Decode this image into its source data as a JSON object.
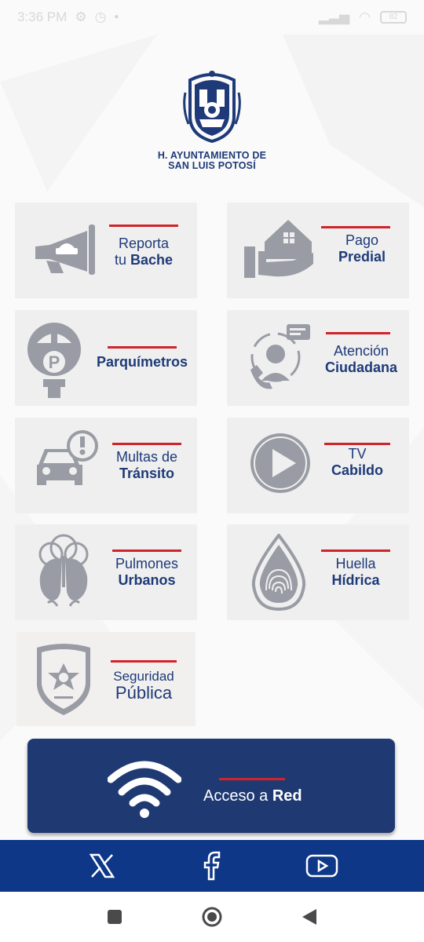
{
  "status": {
    "time": "3:36 PM",
    "battery": "82"
  },
  "brand": {
    "line1": "H. AYUNTAMIENTO DE",
    "line2": "SAN LUIS POTOSÍ"
  },
  "tiles": [
    {
      "line1": "Reporta",
      "line2": "tu ",
      "line2b": "Bache",
      "icon": "megaphone-icon"
    },
    {
      "line1": "Pago",
      "line2b": "Predial",
      "icon": "house-hand-icon"
    },
    {
      "line1b": "Parquímetros",
      "icon": "parking-meter-icon"
    },
    {
      "line1": "Atención",
      "line2b": "Ciudadana",
      "icon": "call-center-icon"
    },
    {
      "line1": "Multas de",
      "line2b": "Tránsito",
      "icon": "car-alert-icon"
    },
    {
      "line1": "TV",
      "line2b": "Cabildo",
      "icon": "play-icon"
    },
    {
      "line1": "Pulmones",
      "line2b": "Urbanos",
      "icon": "lungs-tree-icon"
    },
    {
      "line1": "Huella",
      "line2b": "Hídrica",
      "icon": "water-drop-fingerprint-icon"
    },
    {
      "line1": "Seguridad",
      "line2": "Pública",
      "icon": "police-badge-icon"
    }
  ],
  "wifi": {
    "label": "Acceso a ",
    "label_bold": "Red",
    "icon": "wifi-icon"
  },
  "social": [
    "x-icon",
    "facebook-icon",
    "youtube-icon"
  ],
  "colors": {
    "navy": "#1f3a73",
    "red": "#d0232a",
    "gray_icon": "#9a9ca5",
    "social_bar": "#0e3787"
  }
}
